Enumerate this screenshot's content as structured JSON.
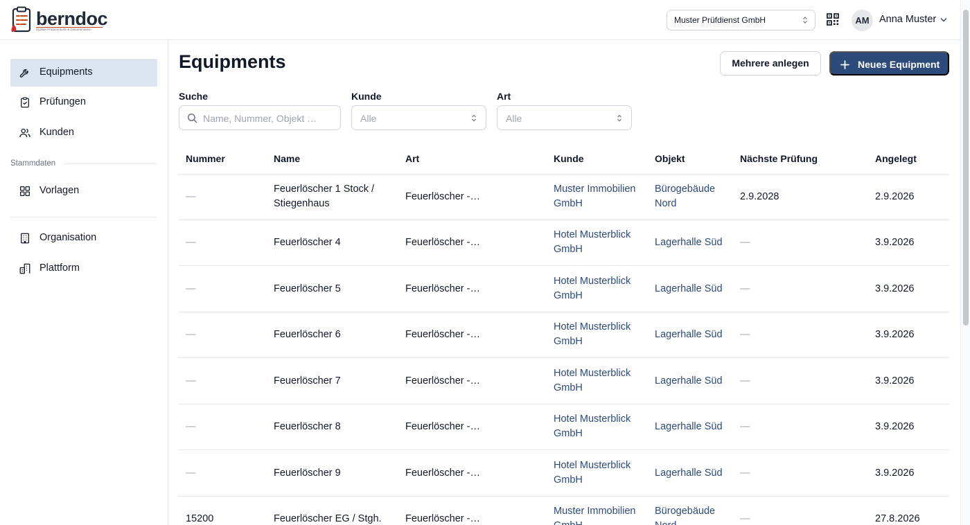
{
  "app": {
    "logo_text": "berndoc",
    "logo_tagline": "Digitale Prüfprotokolle & Dokumentation"
  },
  "header": {
    "org_select_value": "Muster Prüfdienst GmbH",
    "user_initials": "AM",
    "user_name": "Anna Muster"
  },
  "sidebar": {
    "items": [
      {
        "label": "Equipments",
        "icon": "wrench-icon",
        "active": true
      },
      {
        "label": "Prüfungen",
        "icon": "clipboard-check-icon",
        "active": false
      },
      {
        "label": "Kunden",
        "icon": "users-icon",
        "active": false
      }
    ],
    "section_label": "Stammdaten",
    "stamm_items": [
      {
        "label": "Vorlagen",
        "icon": "grid-icon"
      }
    ],
    "bottom_items": [
      {
        "label": "Organisation",
        "icon": "building-icon"
      },
      {
        "label": "Plattform",
        "icon": "buildings-icon"
      }
    ]
  },
  "main": {
    "title": "Equipments",
    "btn_multi": "Mehrere anlegen",
    "btn_new": "Neues Equipment",
    "filters": {
      "search_label": "Suche",
      "search_placeholder": "Name, Nummer, Objekt …",
      "kunde_label": "Kunde",
      "kunde_value": "Alle",
      "art_label": "Art",
      "art_value": "Alle"
    },
    "table": {
      "headers": [
        "Nummer",
        "Name",
        "Art",
        "Kunde",
        "Objekt",
        "Nächste Prüfung",
        "Angelegt"
      ],
      "rows": [
        {
          "nummer": "—",
          "name": [
            "Feuerlöscher 1 Stock /",
            "Stiegenhaus"
          ],
          "art": "Feuerlöscher - Pulverlöscher",
          "kunde": [
            "Muster Immobilien",
            "GmbH"
          ],
          "objekt": [
            "Bürogebäude",
            "Nord"
          ],
          "naechste": "2.9.2028",
          "angelegt": "2.9.2026"
        },
        {
          "nummer": "—",
          "name": [
            "Feuerlöscher 4"
          ],
          "art": "Feuerlöscher - Pulverlöscher",
          "kunde": [
            "Hotel Musterblick",
            "GmbH"
          ],
          "objekt": [
            "Lagerhalle Süd"
          ],
          "naechste": "—",
          "angelegt": "3.9.2026"
        },
        {
          "nummer": "—",
          "name": [
            "Feuerlöscher 5"
          ],
          "art": "Feuerlöscher - Pulverlöscher",
          "kunde": [
            "Hotel Musterblick",
            "GmbH"
          ],
          "objekt": [
            "Lagerhalle Süd"
          ],
          "naechste": "—",
          "angelegt": "3.9.2026"
        },
        {
          "nummer": "—",
          "name": [
            "Feuerlöscher 6"
          ],
          "art": "Feuerlöscher - Pulverlöscher",
          "kunde": [
            "Hotel Musterblick",
            "GmbH"
          ],
          "objekt": [
            "Lagerhalle Süd"
          ],
          "naechste": "—",
          "angelegt": "3.9.2026"
        },
        {
          "nummer": "—",
          "name": [
            "Feuerlöscher 7"
          ],
          "art": "Feuerlöscher - Pulverlöscher",
          "kunde": [
            "Hotel Musterblick",
            "GmbH"
          ],
          "objekt": [
            "Lagerhalle Süd"
          ],
          "naechste": "—",
          "angelegt": "3.9.2026"
        },
        {
          "nummer": "—",
          "name": [
            "Feuerlöscher 8"
          ],
          "art": "Feuerlöscher - Pulverlöscher",
          "kunde": [
            "Hotel Musterblick",
            "GmbH"
          ],
          "objekt": [
            "Lagerhalle Süd"
          ],
          "naechste": "—",
          "angelegt": "3.9.2026"
        },
        {
          "nummer": "—",
          "name": [
            "Feuerlöscher 9"
          ],
          "art": "Feuerlöscher - Pulverlöscher",
          "kunde": [
            "Hotel Musterblick",
            "GmbH"
          ],
          "objekt": [
            "Lagerhalle Süd"
          ],
          "naechste": "—",
          "angelegt": "3.9.2026"
        },
        {
          "nummer": "15200",
          "name": [
            "Feuerlöscher EG / Stgh."
          ],
          "art": "Feuerlöscher - Pulverlöscher",
          "kunde": [
            "Muster Immobilien",
            "GmbH"
          ],
          "objekt": [
            "Bürogebäude",
            "Nord"
          ],
          "naechste": "—",
          "angelegt": "27.8.2026"
        }
      ]
    }
  },
  "colors": {
    "primary": "#2c4a7a",
    "active_nav_bg": "#dbe4ef",
    "link": "#2c4a7a",
    "border": "#e5e7eb",
    "logo_accent": "#c2410c"
  }
}
